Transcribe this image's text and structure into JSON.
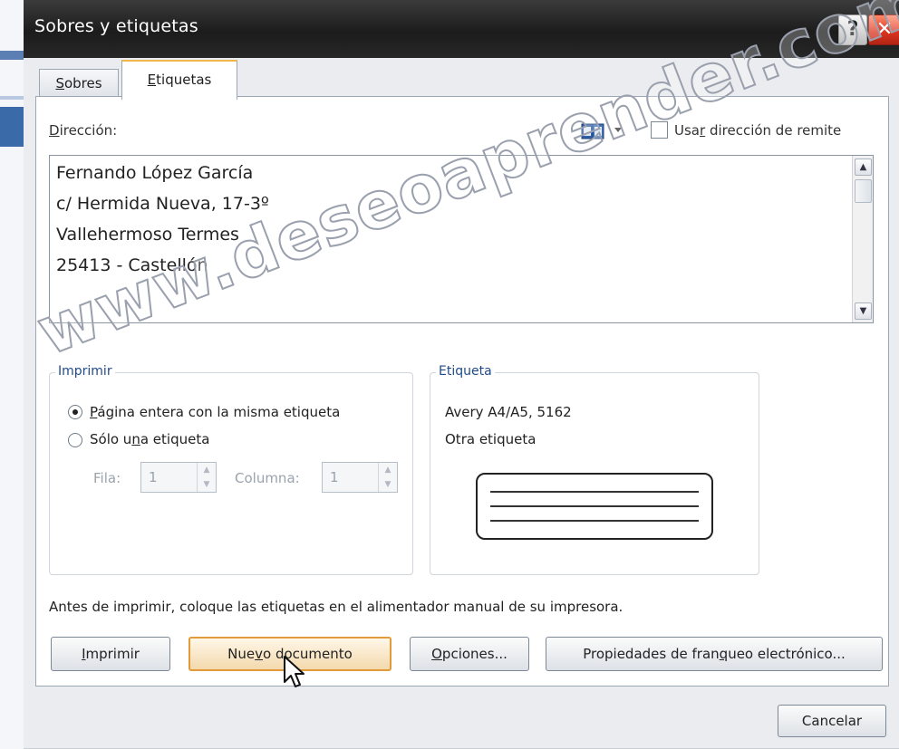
{
  "window": {
    "title": "Sobres y etiquetas",
    "help_label": "?",
    "close_label": "✕"
  },
  "tabs": [
    {
      "pre": "",
      "accel": "S",
      "post": "obres"
    },
    {
      "pre": "",
      "accel": "E",
      "post": "tiquetas",
      "active": true
    }
  ],
  "address": {
    "label_accel": "D",
    "label_rest": "irección:",
    "use_return_pre": "Usa",
    "use_return_accel": "r",
    "use_return_post": " dirección de remite",
    "lines": [
      "Fernando López García",
      "c/ Hermida Nueva, 17-3º",
      "Vallehermoso Termes",
      "25413 - Castellón"
    ]
  },
  "imprimir": {
    "legend": "Imprimir",
    "option1_accel": "P",
    "option1_rest": "ágina entera con la misma etiqueta",
    "option1_selected": true,
    "option2_pre": "Sólo u",
    "option2_accel": "n",
    "option2_post": "a etiqueta",
    "fila_label": "Fila:",
    "fila_value": "1",
    "columna_label": "Columna:",
    "columna_value": "1"
  },
  "etiqueta": {
    "legend": "Etiqueta",
    "product": "Avery A4/A5, 5162",
    "type": "Otra etiqueta"
  },
  "note": "Antes de imprimir, coloque las etiquetas en el alimentador manual de su impresora.",
  "buttons": {
    "imprimir_accel": "I",
    "imprimir_rest": "mprimir",
    "nuevo_pre": "Nue",
    "nuevo_accel": "v",
    "nuevo_post": "o documento",
    "opciones_accel": "O",
    "opciones_rest": "pciones...",
    "franqueo_pre": "Propiedades de fran",
    "franqueo_accel": "q",
    "franqueo_post": "ueo electrónico...",
    "cancelar": "Cancelar"
  },
  "watermark": "www.deseoaprender.com",
  "colors": {
    "title_bar": "#1c1c1c",
    "close_button": "#d8321e",
    "active_tab_accent": "#f0b64c",
    "group_legend": "#1f4a8a",
    "default_button_border": "#e29a3a"
  },
  "icons": {
    "address_book": "address-book-icon",
    "cursor": "mouse-pointer-icon"
  }
}
